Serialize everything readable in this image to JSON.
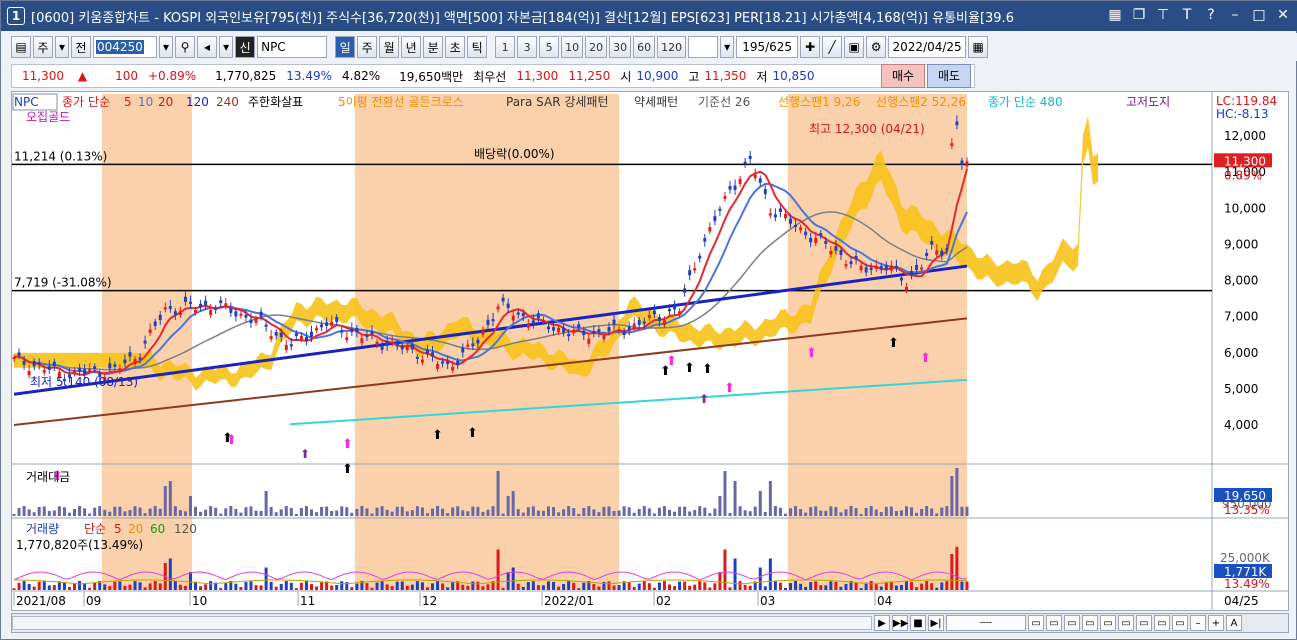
{
  "window": {
    "number": "1",
    "title": "[0600] 키움종합차트 - KOSPI 외국인보유[795(천)] 주식수[36,720(천)] 액면[500] 자본금[184(억)] 결산[12월] EPS[623] PER[18.21] 시가총액[4,168(억)] 유통비율[39.6"
  },
  "toolbar": {
    "period_type": "주",
    "prev_label": "전",
    "code": "004250",
    "credit_label": "신",
    "name": "NPC",
    "period_buttons": [
      "일",
      "주",
      "월",
      "년",
      "분",
      "초",
      "틱"
    ],
    "selected_period": "일",
    "interval_buttons": [
      "1",
      "3",
      "5",
      "10",
      "20",
      "30",
      "60",
      "120"
    ],
    "count": "195/625",
    "date": "2022/04/25"
  },
  "quote": {
    "price": "11,300",
    "change_arrow": "▲",
    "change": "100",
    "change_pct": "+0.89%",
    "volume": "1,770,825",
    "vol_ratio": "13.49%",
    "turnover": "4.82%",
    "amount": "19,650백만",
    "priority_label": "최우선",
    "ask": "11,300",
    "bid": "11,250",
    "open_label": "시",
    "open": "10,900",
    "high_label": "고",
    "high": "11,350",
    "low_label": "저",
    "low": "10,850",
    "buy_label": "매수",
    "sell_label": "매도"
  },
  "legend": {
    "name": "NPC",
    "ma_label": "종가 단순",
    "ma": [
      "5",
      "10",
      "20",
      "120",
      "240"
    ],
    "indicator1": "주한화살표",
    "indicator2": "5이평 전환선 골든크로스",
    "indicator3": "Para SAR 강세패턴",
    "indicator4": "약세패턴",
    "kijun": "기준선 26",
    "senkou1": "선행스팬1 9,26",
    "senkou2": "선행스팬2 52,26",
    "ma480": "종가 단순 480",
    "gojeo": "고저도지",
    "ojip": "오집골드",
    "lc": "LC:119.84",
    "hc": "HC:-8.13"
  },
  "price_panel": {
    "hline1_label": "11,214 (0.13%)",
    "hline2_label": "7,719 (-31.08%)",
    "dividend_label": "배당락(0.00%)",
    "high_label": "최고 12,300 (04/21)",
    "low_label": "최저 5,140 (08/13)",
    "current_price": "11,300",
    "current_pct": "0.89%",
    "y_ticks": [
      "12,000",
      "11,000",
      "10,000",
      "9,000",
      "8,000",
      "7,000",
      "6,000",
      "5,000",
      "4,000"
    ]
  },
  "amount_panel": {
    "title": "거래대금",
    "scale_label": "950,000",
    "current": "19,650",
    "pct": "13.35%"
  },
  "volume_panel": {
    "title": "거래량",
    "ma_label": "단순",
    "ma": [
      "5",
      "20",
      "60",
      "120"
    ],
    "value_label": "1,770,820주(13.49%)",
    "scale_label": "25,000K",
    "current": "1,771K",
    "pct": "13.49%"
  },
  "x_axis": {
    "labels": [
      "2021/08",
      "09",
      "10",
      "11",
      "12",
      "2022/01",
      "02",
      "03",
      "04"
    ],
    "right_label": "04/25"
  },
  "colors": {
    "highlight": "#f9c99b",
    "ma5": "#e8282c",
    "ma10": "#4a76d8",
    "ma120": "#1a22c0",
    "ma240": "#8b3a1f",
    "ma480": "#33d6d6",
    "kijun": "#7f7f7f",
    "cloud": "#f7c21a",
    "price_badge": "#e02020",
    "blue_badge": "#1a50c0"
  }
}
